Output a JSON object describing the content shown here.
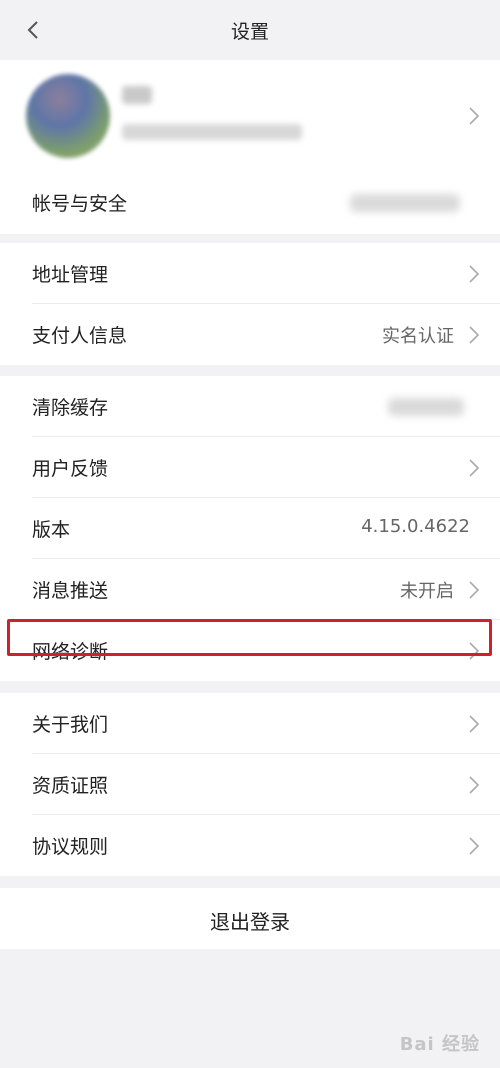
{
  "header": {
    "title": "设置"
  },
  "account": {
    "label": "帐号与安全"
  },
  "rows_group2": [
    {
      "label": "地址管理",
      "value": ""
    },
    {
      "label": "支付人信息",
      "value": "实名认证"
    }
  ],
  "rows_group3": [
    {
      "label": "清除缓存",
      "value": ""
    },
    {
      "label": "用户反馈",
      "value": ""
    },
    {
      "label": "版本",
      "value": "4.15.0.4622"
    },
    {
      "label": "消息推送",
      "value": "未开启"
    },
    {
      "label": "网络诊断",
      "value": ""
    }
  ],
  "rows_group4": [
    {
      "label": "关于我们"
    },
    {
      "label": "资质证照"
    },
    {
      "label": "协议规则"
    }
  ],
  "logout": {
    "label": "退出登录"
  },
  "watermark": {
    "text": "Bai 经验"
  },
  "colors": {
    "highlight": "#d21f2b",
    "background": "#f2f2f4"
  }
}
